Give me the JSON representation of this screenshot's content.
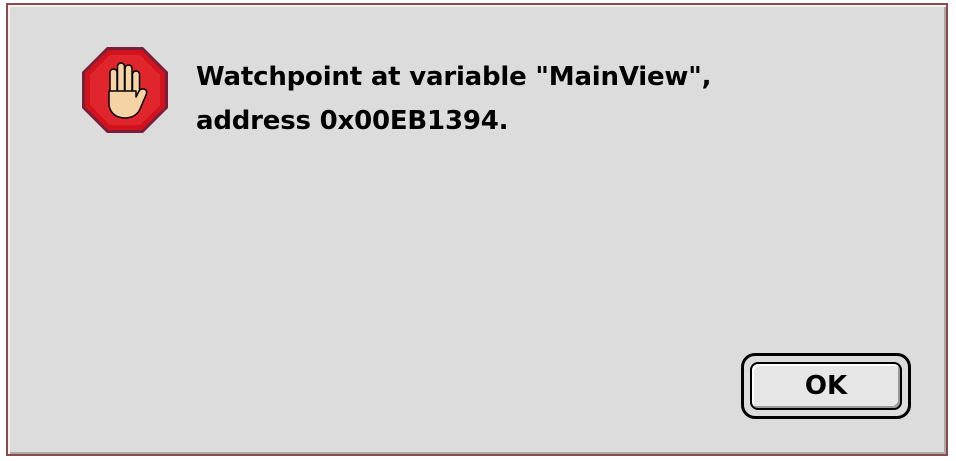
{
  "dialog": {
    "icon": "stop-hand-icon",
    "message_line1": "Watchpoint at variable \"MainView\",",
    "message_line2": "address 0x00EB1394.",
    "ok_label": "OK"
  },
  "colors": {
    "dialog_background": "#dcdcdc",
    "stop_sign_red": "#d2131e",
    "hand_skin": "#f6d3a4"
  }
}
